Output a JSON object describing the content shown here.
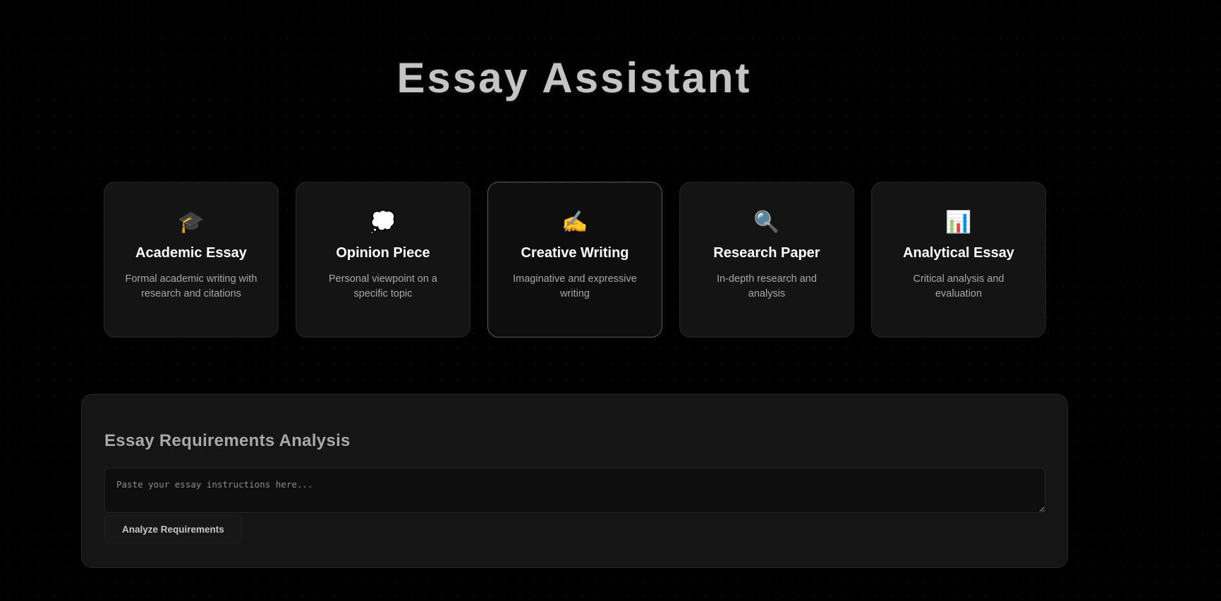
{
  "header": {
    "title": "Essay Assistant"
  },
  "essay_types": [
    {
      "icon": "graduation-cap-icon",
      "glyph": "🎓",
      "title": "Academic Essay",
      "description": "Formal academic writing with research and citations"
    },
    {
      "icon": "thought-bubble-icon",
      "glyph": "💭",
      "title": "Opinion Piece",
      "description": "Personal viewpoint on a specific topic"
    },
    {
      "icon": "writing-hand-icon",
      "glyph": "✍️",
      "title": "Creative Writing",
      "description": "Imaginative and expressive writing"
    },
    {
      "icon": "magnifying-glass-icon",
      "glyph": "🔍",
      "title": "Research Paper",
      "description": "In-depth research and analysis"
    },
    {
      "icon": "bar-chart-icon",
      "glyph": "📊",
      "title": "Analytical Essay",
      "description": "Critical analysis and evaluation"
    }
  ],
  "selected_essay_type": "Creative Writing",
  "analysis": {
    "title": "Essay Requirements Analysis",
    "input_value": "",
    "input_placeholder": "Paste your essay instructions here...",
    "button_label": "Analyze Requirements"
  }
}
